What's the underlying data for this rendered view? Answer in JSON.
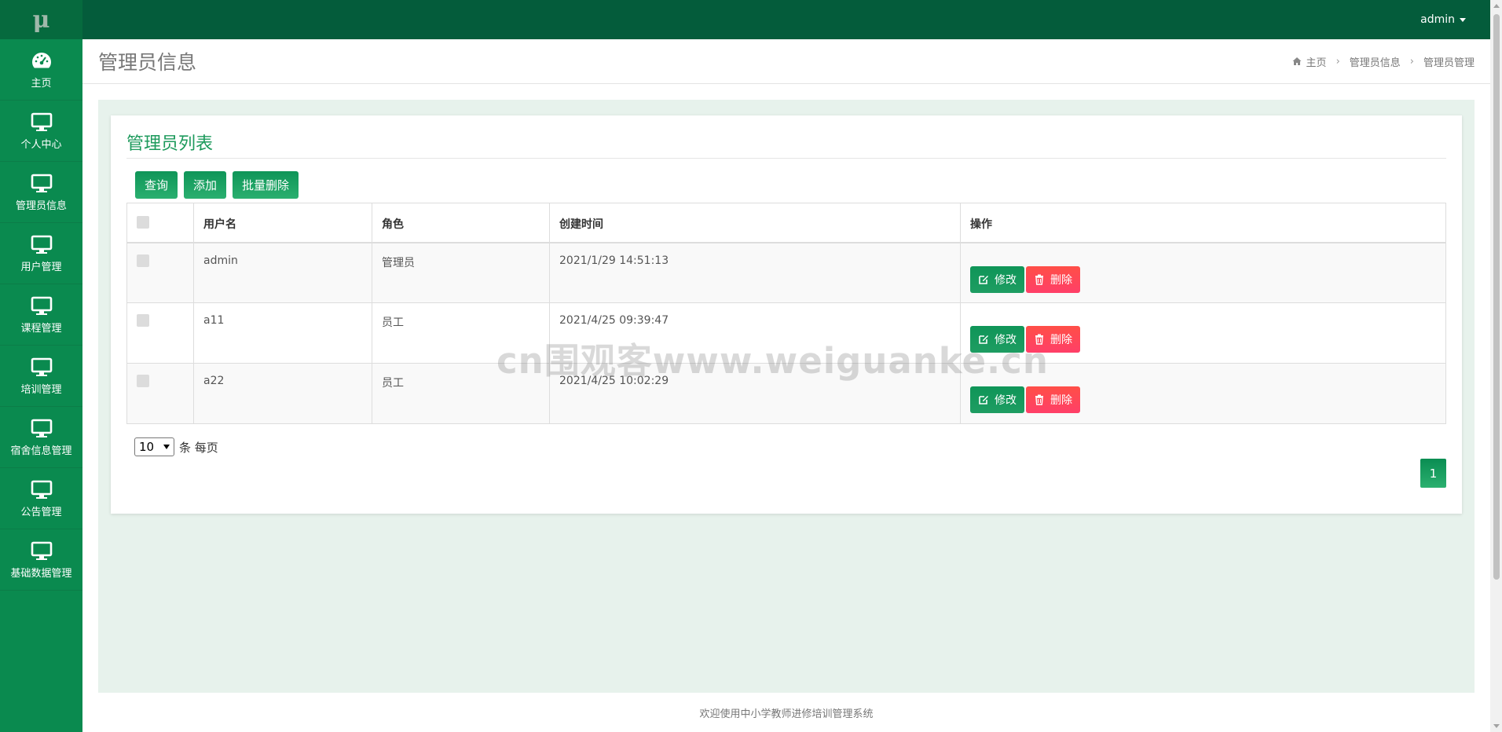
{
  "sidebar": {
    "logo": "μ",
    "items": [
      {
        "label": "主页",
        "icon": "dashboard-icon"
      },
      {
        "label": "个人中心",
        "icon": "monitor-icon"
      },
      {
        "label": "管理员信息",
        "icon": "monitor-icon"
      },
      {
        "label": "用户管理",
        "icon": "monitor-icon"
      },
      {
        "label": "课程管理",
        "icon": "monitor-icon"
      },
      {
        "label": "培训管理",
        "icon": "monitor-icon"
      },
      {
        "label": "宿舍信息管理",
        "icon": "monitor-icon"
      },
      {
        "label": "公告管理",
        "icon": "monitor-icon"
      },
      {
        "label": "基础数据管理",
        "icon": "monitor-icon"
      }
    ]
  },
  "topbar": {
    "user": "admin"
  },
  "header": {
    "title": "管理员信息",
    "breadcrumb": [
      "主页",
      "管理员信息",
      "管理员管理"
    ]
  },
  "panel": {
    "title": "管理员列表",
    "buttons": {
      "query": "查询",
      "add": "添加",
      "batch_delete": "批量删除"
    },
    "columns": [
      "用户名",
      "角色",
      "创建时间",
      "操作"
    ],
    "rows": [
      {
        "username": "admin",
        "role": "管理员",
        "created": "2021/1/29 14:51:13"
      },
      {
        "username": "a11",
        "role": "员工",
        "created": "2021/4/25 09:39:47"
      },
      {
        "username": "a22",
        "role": "员工",
        "created": "2021/4/25 10:02:29"
      }
    ],
    "row_actions": {
      "edit": "修改",
      "delete": "删除"
    },
    "pager": {
      "page_size": "10",
      "suffix": "条 每页",
      "current_page": "1"
    }
  },
  "watermark": "cn围观客www.weiguanke.cn",
  "footer": "欢迎使用中小学教师进修培训管理系统",
  "colors": {
    "sidebar": "#0a8a4f",
    "topbar": "#045c3b",
    "accent": "#1d9a5c",
    "danger": "#ff4f47"
  }
}
